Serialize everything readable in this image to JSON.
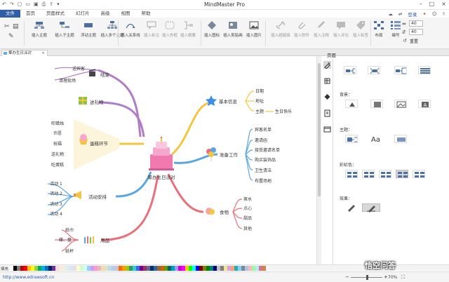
{
  "app": {
    "title": "MindMaster Pro"
  },
  "menu": {
    "file": "文件",
    "items": [
      "首页",
      "页面样式",
      "幻灯片",
      "高级",
      "视图",
      "帮助"
    ],
    "login": "登录"
  },
  "ribbon": {
    "buttons": [
      {
        "label": "插入主题"
      },
      {
        "label": "插入子主题"
      },
      {
        "label": "浮动主题"
      },
      {
        "label": "插入多个主题"
      },
      {
        "label": "插入关系线"
      },
      {
        "label": "插入标注"
      },
      {
        "label": "插入外框"
      },
      {
        "label": "插入概要"
      },
      {
        "label": "插入图标"
      },
      {
        "label": "插入剪贴画"
      },
      {
        "label": "插入图片"
      },
      {
        "label": "插入超链接"
      },
      {
        "label": "插入附件"
      },
      {
        "label": "插入注释"
      },
      {
        "label": "插入评论"
      },
      {
        "label": "插入标签"
      },
      {
        "label": "布局"
      },
      {
        "label": "编号"
      }
    ],
    "spin1": "40",
    "spin2": "40",
    "reset": "重置"
  },
  "tab": {
    "name": "筹办生日派对"
  },
  "panel": {
    "title": "页面",
    "bg_label": "背景：",
    "theme_label": "主题：",
    "rainbow_label": "彩虹色：",
    "effect_label": "效果："
  },
  "mindmap": {
    "center": "筹办生日派对",
    "branches": [
      {
        "label": "结束",
        "children": [
          "送宾客",
          "清理现场"
        ]
      },
      {
        "label": "送礼物",
        "children": []
      },
      {
        "label": "蛋糕环节",
        "children": [
          "吹蜡烛",
          "许愿",
          "祝福",
          "送礼物",
          "吃蛋糕"
        ]
      },
      {
        "label": "活动安排",
        "children": [
          "活动 1",
          "活动 2",
          "活动 3",
          "活动 4"
        ]
      },
      {
        "label": "用品",
        "children": [
          "纸巾",
          "碟、盘",
          "纸杯"
        ]
      },
      {
        "label": "基本信息",
        "children": [
          "日期",
          "地址",
          "主题"
        ],
        "extra": "生日快乐"
      },
      {
        "label": "准备工作",
        "children": [
          "宾客名单",
          "邀请函",
          "接受邀请名单",
          "购买装饰品",
          "卫生清洁",
          "布置场地"
        ]
      },
      {
        "label": "食物",
        "children": [
          "茶水",
          "点心",
          "甜品",
          "其他"
        ]
      }
    ]
  },
  "colors": {
    "accent": "#2e5ea8",
    "purple": "#b07cc6",
    "yellow": "#f5c542",
    "blue": "#5aa6e0",
    "red": "#e96f7a"
  },
  "fill_label": "填充",
  "status": {
    "url": "http://www.edrawsoft.cn",
    "zoom": "70%"
  },
  "watermark": "悟空问答"
}
